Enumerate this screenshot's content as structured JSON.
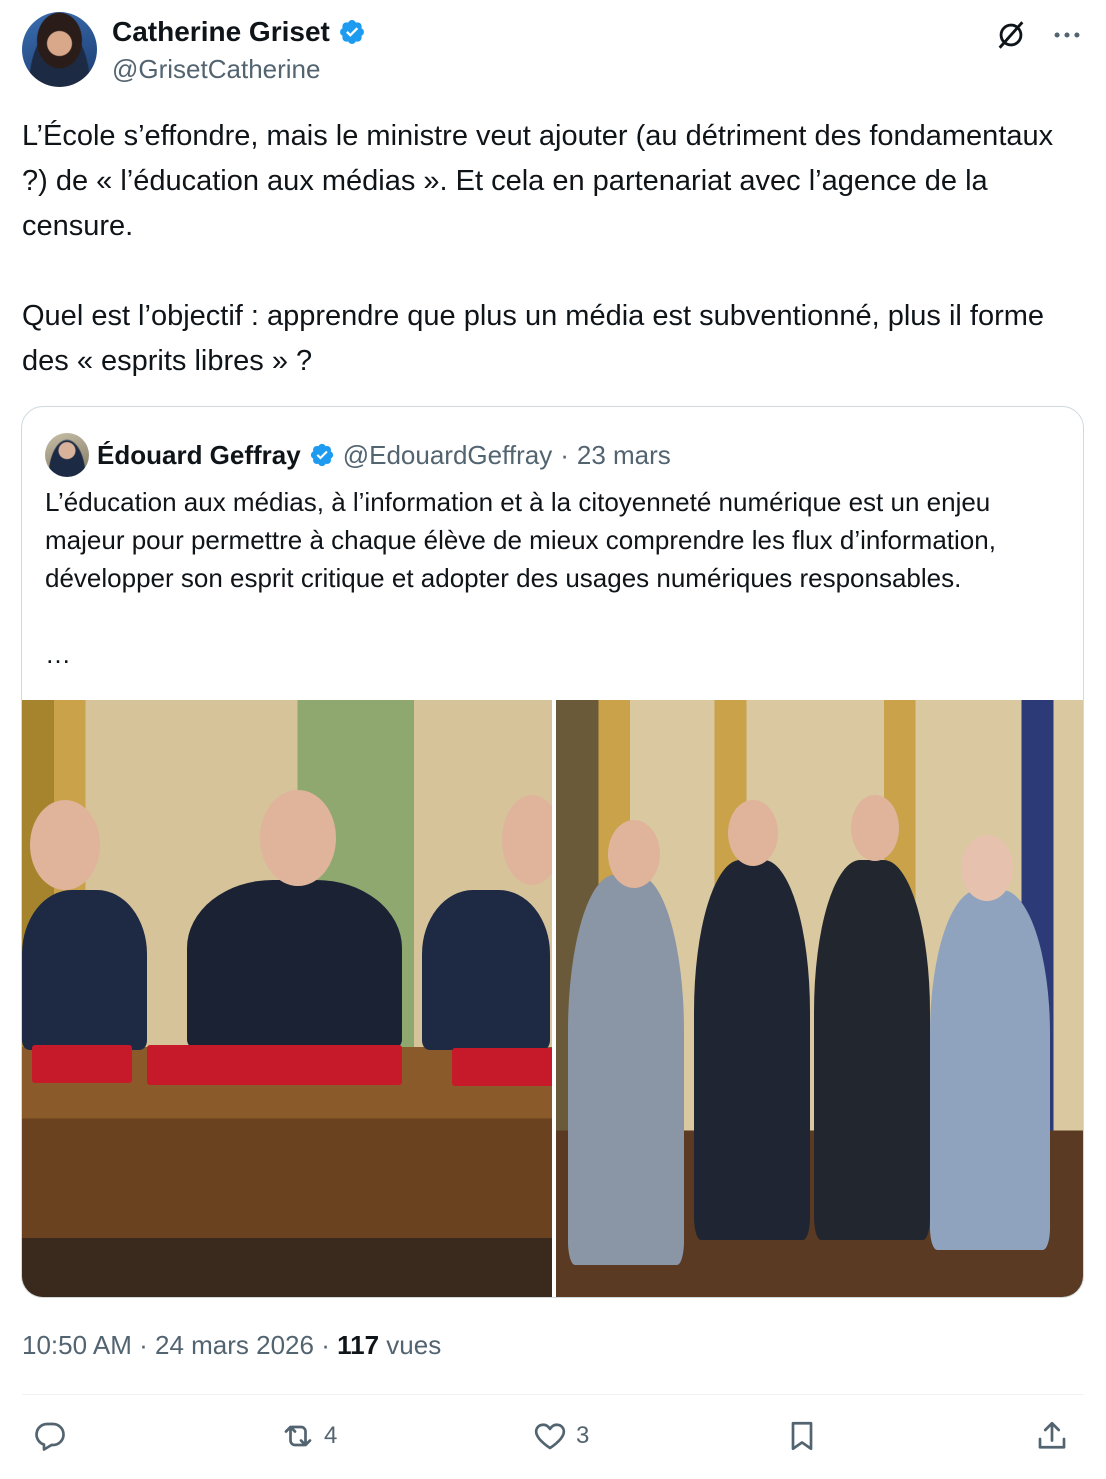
{
  "author": {
    "name": "Catherine Griset",
    "handle": "@GrisetCatherine"
  },
  "tweet": {
    "text": "L’École s’effondre, mais le ministre veut ajouter (au détriment des fondamentaux ?) de « l’éducation aux médias ». Et cela en partenariat avec l’agence de la censure.\n\nQuel est l’objectif : apprendre que plus un média est subventionné, plus il forme des « esprits libres » ?",
    "time": "10:50 AM",
    "date": "24 mars 2026",
    "views_count": "117",
    "views_label": "vues"
  },
  "quote": {
    "name": "Édouard Geffray",
    "handle": "@EdouardGeffray",
    "date": "23 mars",
    "text": "L’éducation aux médias, à l’information et à la citoyenneté numérique est un enjeu majeur pour permettre à chaque élève de mieux comprendre les flux d’information, développer son esprit critique et adopter des usages numériques responsables.",
    "ellipsis": "…"
  },
  "actions": {
    "reply_count": "",
    "retweet_count": "4",
    "like_count": "3"
  },
  "icons": {
    "verified": "verified-badge-icon",
    "grok": "grok-icon",
    "more": "more-icon",
    "reply": "reply-icon",
    "retweet": "retweet-icon",
    "like": "heart-icon",
    "bookmark": "bookmark-icon",
    "share": "share-icon"
  },
  "colors": {
    "verified": "#1d9bf0",
    "secondary_text": "#536471",
    "primary_text": "#0f1419",
    "border": "#cfd9de"
  }
}
